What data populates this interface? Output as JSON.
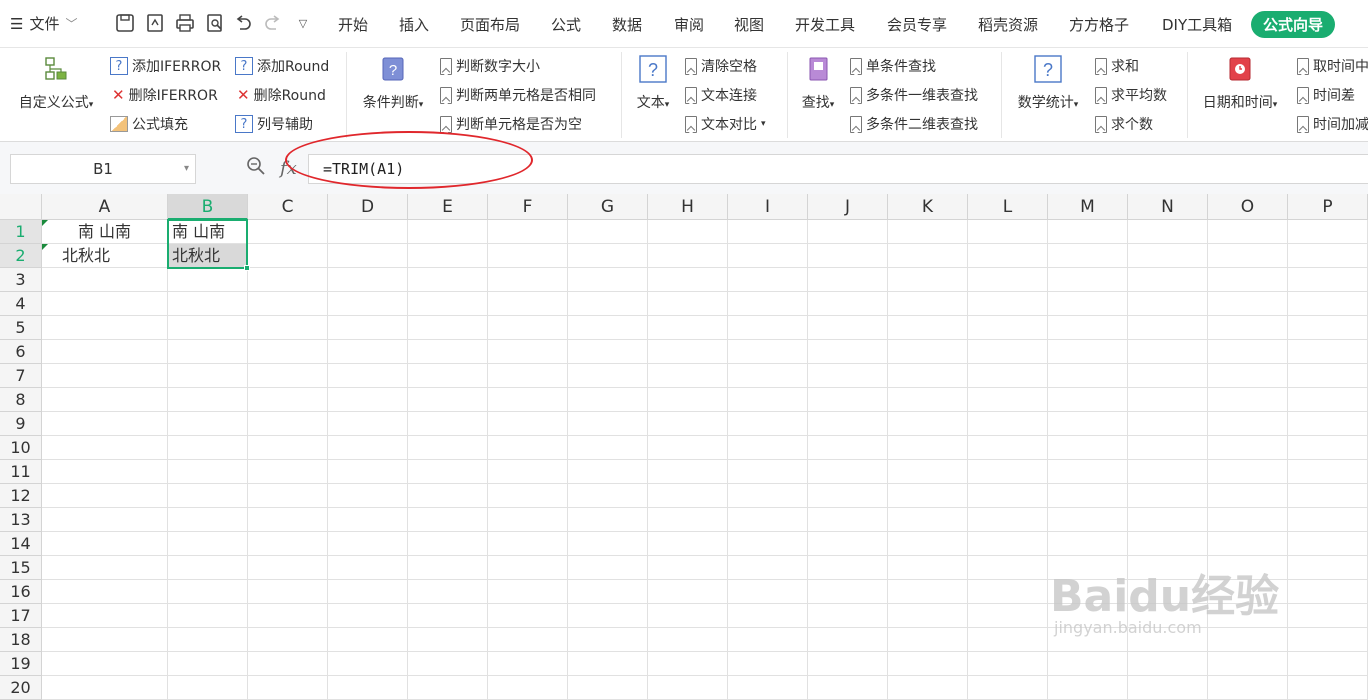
{
  "menubar": {
    "file_label": "文件",
    "items": [
      "开始",
      "插入",
      "页面布局",
      "公式",
      "数据",
      "审阅",
      "视图",
      "开发工具",
      "会员专享",
      "稻壳资源",
      "方方格子",
      "DIY工具箱",
      "公式向导"
    ],
    "active_index": 12
  },
  "ribbon": {
    "custom_formula": "自定义公式",
    "add_iferror": "添加IFERROR",
    "del_iferror": "删除IFERROR",
    "formula_fill": "公式填充",
    "add_round": "添加Round",
    "del_round": "删除Round",
    "col_assist": "列号辅助",
    "cond_judge": "条件判断",
    "judge_num_size": "判断数字大小",
    "judge_two_cells": "判断两单元格是否相同",
    "judge_cell_empty": "判断单元格是否为空",
    "text": "文本",
    "clear_spaces": "清除空格",
    "text_concat": "文本连接",
    "text_compare": "文本对比",
    "lookup": "查找",
    "single_lookup": "单条件查找",
    "multi_1d_lookup": "多条件一维表查找",
    "multi_2d_lookup": "多条件二维表查找",
    "math_stats": "数学统计",
    "sum": "求和",
    "average": "求平均数",
    "count": "求个数",
    "datetime": "日期和时间",
    "get_time": "取时间中",
    "time_diff": "时间差",
    "time_add": "时间加减"
  },
  "formula_bar": {
    "name_box": "B1",
    "formula": "=TRIM(A1)"
  },
  "grid": {
    "columns": [
      "A",
      "B",
      "C",
      "D",
      "E",
      "F",
      "G",
      "H",
      "I",
      "J",
      "K",
      "L",
      "M",
      "N",
      "O",
      "P"
    ],
    "rows": [
      "1",
      "2",
      "3",
      "4",
      "5",
      "6",
      "7",
      "8",
      "9",
      "10",
      "11",
      "12",
      "13",
      "14",
      "15",
      "16",
      "17",
      "18",
      "19",
      "20"
    ],
    "cells": {
      "A1": "南 山南",
      "B1": "南 山南",
      "A2": "北秋北",
      "B2": "北秋北"
    }
  },
  "watermark": {
    "main": "Baidu经验",
    "sub": "jingyan.baidu.com"
  },
  "colors": {
    "accent": "#1aad70",
    "annotation": "#e0272c"
  }
}
